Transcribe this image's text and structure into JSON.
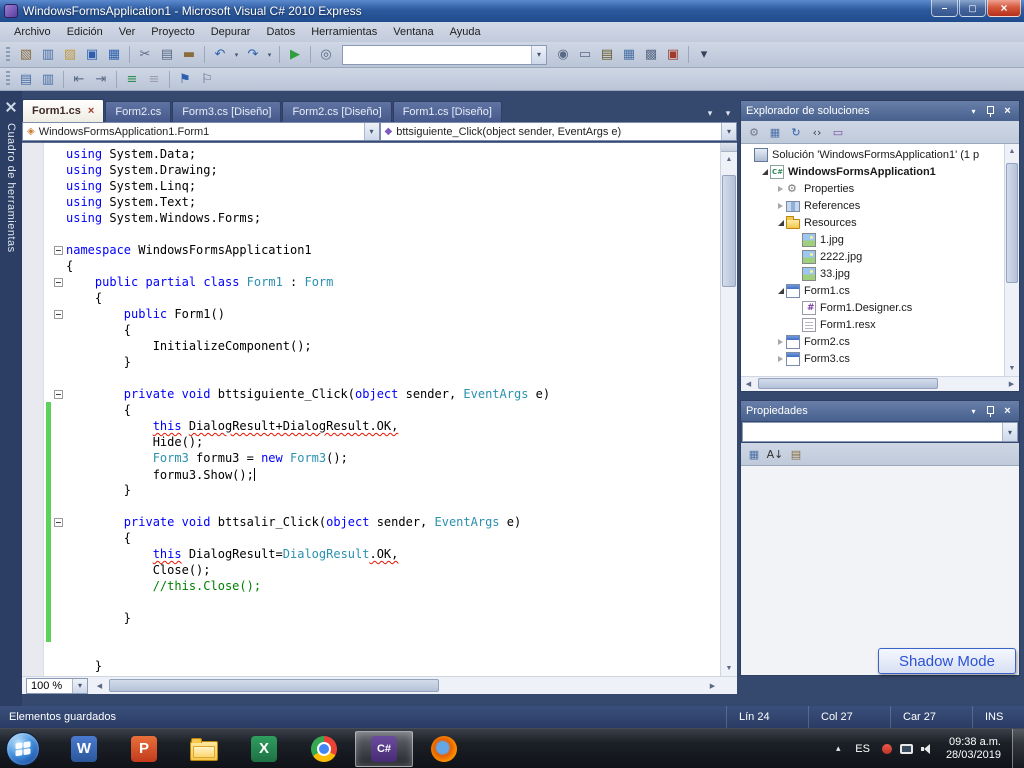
{
  "window": {
    "title": "WindowsFormsApplication1 - Microsoft Visual C# 2010 Express"
  },
  "menu": {
    "items": [
      "Archivo",
      "Edición",
      "Ver",
      "Proyecto",
      "Depurar",
      "Datos",
      "Herramientas",
      "Ventana",
      "Ayuda"
    ]
  },
  "toolbars": {
    "standard": [
      "new-project",
      "add-new-item",
      "open-file",
      "save",
      "save-all",
      "sep",
      "cut",
      "copy",
      "paste",
      "sep",
      "undo",
      "dd",
      "redo",
      "dd",
      "sep",
      "start-debugging",
      "sep",
      "find-symbol",
      "combo",
      "find-in-files",
      "command-window",
      "solution-explorer",
      "properties-window",
      "toolbox-window",
      "error-list",
      "sep",
      "overflow"
    ],
    "text_editor": [
      "member-list",
      "parameter-info",
      "sep",
      "indent-decrease",
      "indent-increase",
      "sep",
      "comment",
      "uncomment",
      "sep",
      "toggle-bookmark",
      "clear-bookmarks"
    ]
  },
  "documents": {
    "tabs": [
      {
        "label": "Form1.cs",
        "active": true
      },
      {
        "label": "Form2.cs"
      },
      {
        "label": "Form3.cs [Diseño]"
      },
      {
        "label": "Form2.cs [Diseño]"
      },
      {
        "label": "Form1.cs [Diseño]"
      }
    ]
  },
  "navbar": {
    "type_value": "WindowsFormsApplication1.Form1",
    "member_value": "bttsiguiente_Click(object sender, EventArgs e)"
  },
  "editor": {
    "zoom_label": "100 %",
    "lines": [
      {
        "s": [
          [
            "using",
            "k"
          ],
          [
            " System.Data;"
          ]
        ]
      },
      {
        "s": [
          [
            "using",
            "k"
          ],
          [
            " System.Drawing;"
          ]
        ]
      },
      {
        "s": [
          [
            "using",
            "k"
          ],
          [
            " System.Linq;"
          ]
        ]
      },
      {
        "s": [
          [
            "using",
            "k"
          ],
          [
            " System.Text;"
          ]
        ]
      },
      {
        "s": [
          [
            "using",
            "k"
          ],
          [
            " System.Windows.Forms;"
          ]
        ]
      },
      {
        "s": []
      },
      {
        "fold": true,
        "s": [
          [
            "namespace",
            "k"
          ],
          [
            " WindowsFormsApplication1"
          ]
        ]
      },
      {
        "s": [
          [
            "{"
          ]
        ]
      },
      {
        "fold": true,
        "s": [
          [
            "    "
          ],
          [
            "public",
            "k"
          ],
          [
            " "
          ],
          [
            "partial",
            "k"
          ],
          [
            " "
          ],
          [
            "class",
            "k"
          ],
          [
            " "
          ],
          [
            "Form1",
            "t"
          ],
          [
            " : "
          ],
          [
            "Form",
            "t"
          ]
        ]
      },
      {
        "s": [
          [
            "    {"
          ]
        ]
      },
      {
        "fold": true,
        "s": [
          [
            "        "
          ],
          [
            "public",
            "k"
          ],
          [
            " Form1()"
          ]
        ]
      },
      {
        "s": [
          [
            "        {"
          ]
        ]
      },
      {
        "s": [
          [
            "            InitializeComponent();"
          ]
        ]
      },
      {
        "s": [
          [
            "        }"
          ]
        ]
      },
      {
        "s": []
      },
      {
        "fold": true,
        "s": [
          [
            "        "
          ],
          [
            "private",
            "k"
          ],
          [
            " "
          ],
          [
            "void",
            "k"
          ],
          [
            " bttsiguiente_Click("
          ],
          [
            "object",
            "k"
          ],
          [
            " sender, "
          ],
          [
            "EventArgs",
            "t"
          ],
          [
            " e)"
          ]
        ]
      },
      {
        "chg": true,
        "s": [
          [
            "        {"
          ]
        ]
      },
      {
        "chg": true,
        "s": [
          [
            "            "
          ],
          [
            "this",
            "k sq"
          ],
          [
            " "
          ],
          [
            "DialogResult+DialogResult.OK,",
            "p sq"
          ]
        ]
      },
      {
        "chg": true,
        "s": [
          [
            "            Hide();"
          ]
        ]
      },
      {
        "chg": true,
        "s": [
          [
            "            "
          ],
          [
            "Form3",
            "t"
          ],
          [
            " formu3 = "
          ],
          [
            "new",
            "k"
          ],
          [
            " "
          ],
          [
            "Form3",
            "t"
          ],
          [
            "();"
          ]
        ]
      },
      {
        "chg": true,
        "caret": true,
        "s": [
          [
            "            formu3.Show();"
          ]
        ]
      },
      {
        "chg": true,
        "s": [
          [
            "        }"
          ]
        ]
      },
      {
        "chg": true,
        "s": []
      },
      {
        "chg": true,
        "fold": true,
        "s": [
          [
            "        "
          ],
          [
            "private",
            "k"
          ],
          [
            " "
          ],
          [
            "void",
            "k"
          ],
          [
            " bttsalir_Click("
          ],
          [
            "object",
            "k"
          ],
          [
            " sender, "
          ],
          [
            "EventArgs",
            "t"
          ],
          [
            " e)"
          ]
        ]
      },
      {
        "chg": true,
        "s": [
          [
            "        {"
          ]
        ]
      },
      {
        "chg": true,
        "s": [
          [
            "            "
          ],
          [
            "this",
            "k sq"
          ],
          [
            " DialogResult="
          ],
          [
            "DialogResult",
            "t"
          ],
          [
            ".OK,",
            "p sq"
          ]
        ]
      },
      {
        "chg": true,
        "s": [
          [
            "            Close();"
          ]
        ]
      },
      {
        "chg": true,
        "s": [
          [
            "            "
          ],
          [
            "//this.Close();",
            "c"
          ]
        ]
      },
      {
        "chg": true,
        "s": []
      },
      {
        "chg": true,
        "s": [
          [
            "        }"
          ]
        ]
      },
      {
        "chg": true,
        "s": []
      },
      {
        "s": []
      },
      {
        "s": [
          [
            "    }"
          ]
        ]
      },
      {
        "s": [
          [
            "}"
          ]
        ]
      }
    ]
  },
  "solution_explorer": {
    "title": "Explorador de soluciones",
    "toolbar": [
      "properties",
      "show-all-files",
      "refresh",
      "view-code",
      "view-designer"
    ],
    "items": [
      {
        "icon": "solution",
        "label": "Solución 'WindowsFormsApplication1' (1 p",
        "indent": 0
      },
      {
        "icon": "csproj",
        "label": "WindowsFormsApplication1",
        "indent": 1,
        "state": "expanded",
        "bold": true
      },
      {
        "icon": "properties",
        "label": "Properties",
        "indent": 2,
        "state": "collapsed"
      },
      {
        "icon": "references",
        "label": "References",
        "indent": 2,
        "state": "collapsed"
      },
      {
        "icon": "folder",
        "label": "Resources",
        "indent": 2,
        "state": "expanded"
      },
      {
        "icon": "image",
        "label": "1.jpg",
        "indent": 3
      },
      {
        "icon": "image",
        "label": "2222.jpg",
        "indent": 3
      },
      {
        "icon": "image",
        "label": "33.jpg",
        "indent": 3
      },
      {
        "icon": "form",
        "label": "Form1.cs",
        "indent": 2,
        "state": "expanded"
      },
      {
        "icon": "csfile",
        "label": "Form1.Designer.cs",
        "indent": 3
      },
      {
        "icon": "resx",
        "label": "Form1.resx",
        "indent": 3
      },
      {
        "icon": "form",
        "label": "Form2.cs",
        "indent": 2,
        "state": "collapsed"
      },
      {
        "icon": "form",
        "label": "Form3.cs",
        "indent": 2,
        "state": "collapsed"
      }
    ]
  },
  "properties_panel": {
    "title": "Propiedades",
    "selector_value": "",
    "toolbar": [
      "categorized",
      "alphabetical",
      "property-pages"
    ]
  },
  "shadow_mode": {
    "label": "Shadow Mode"
  },
  "status_bar": {
    "message": "Elementos guardados",
    "line": "Lín 24",
    "column": "Col 27",
    "character": "Car 27",
    "mode": "INS"
  },
  "taskbar": {
    "apps": [
      {
        "name": "word"
      },
      {
        "name": "powerpoint"
      },
      {
        "name": "explorer"
      },
      {
        "name": "excel"
      },
      {
        "name": "chrome"
      },
      {
        "name": "visual-csharp",
        "active": true
      },
      {
        "name": "firefox"
      }
    ],
    "tray": {
      "language": "ES",
      "time": "09:38 a.m.",
      "date": "28/03/2019"
    }
  },
  "toolbox": {
    "label": "Cuadro de herramientas"
  }
}
